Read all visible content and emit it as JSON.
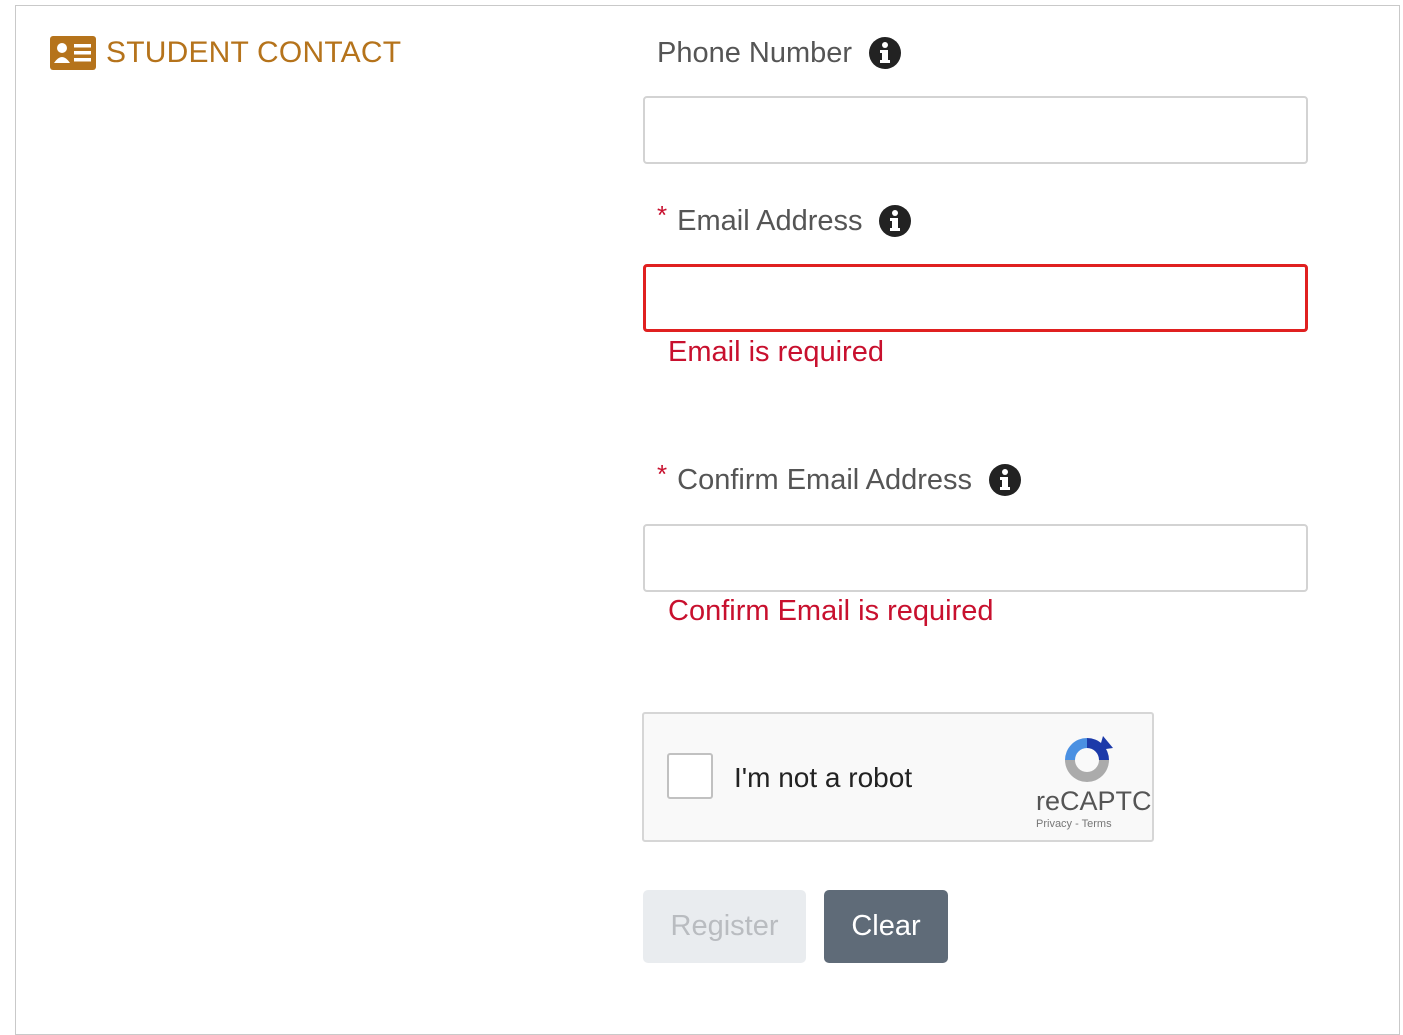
{
  "section": {
    "icon": "contact-card-icon",
    "title": "STUDENT CONTACT",
    "accent_color": "#b5731b"
  },
  "fields": {
    "phone": {
      "label": "Phone Number",
      "required": false,
      "value": "",
      "placeholder": "",
      "info_icon": "info-icon"
    },
    "email": {
      "label": "Email Address",
      "required": true,
      "required_marker": "*",
      "value": "",
      "placeholder": "",
      "error": "Email is required",
      "info_icon": "info-icon"
    },
    "confirm_email": {
      "label": "Confirm Email Address",
      "required": true,
      "required_marker": "*",
      "value": "",
      "placeholder": "",
      "error": "Confirm Email is required",
      "info_icon": "info-icon"
    }
  },
  "recaptcha": {
    "checkbox_label": "I'm not a robot",
    "checked": false,
    "brand": "reCAPTCHA",
    "links": "Privacy - Terms",
    "logo_icon": "recaptcha-logo-icon"
  },
  "buttons": {
    "register": "Register",
    "register_enabled": false,
    "clear": "Clear"
  },
  "colors": {
    "error": "#c8102e",
    "error_border": "#e02020",
    "clear_button": "#5f6b78",
    "register_disabled": "#e9ecef"
  }
}
